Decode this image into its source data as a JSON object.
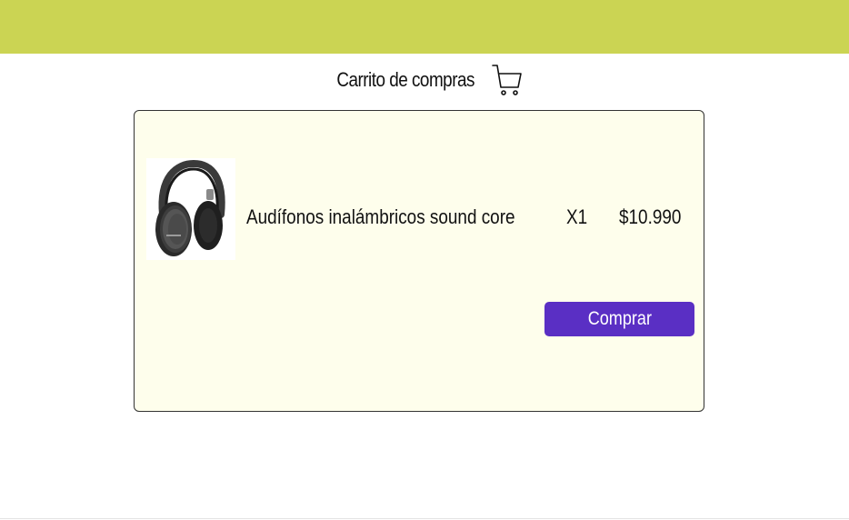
{
  "header": {
    "title": "Carrito de compras",
    "cart_icon": "cart-icon",
    "bar_color": "#cbd453"
  },
  "cart": {
    "items": [
      {
        "name": "Audífonos inalámbricos sound core",
        "quantity": "X1",
        "price": "$10.990",
        "image_icon": "headphones-image"
      }
    ],
    "buy_label": "Comprar",
    "button_color": "#5a2fc4",
    "panel_color": "#fefeec"
  }
}
